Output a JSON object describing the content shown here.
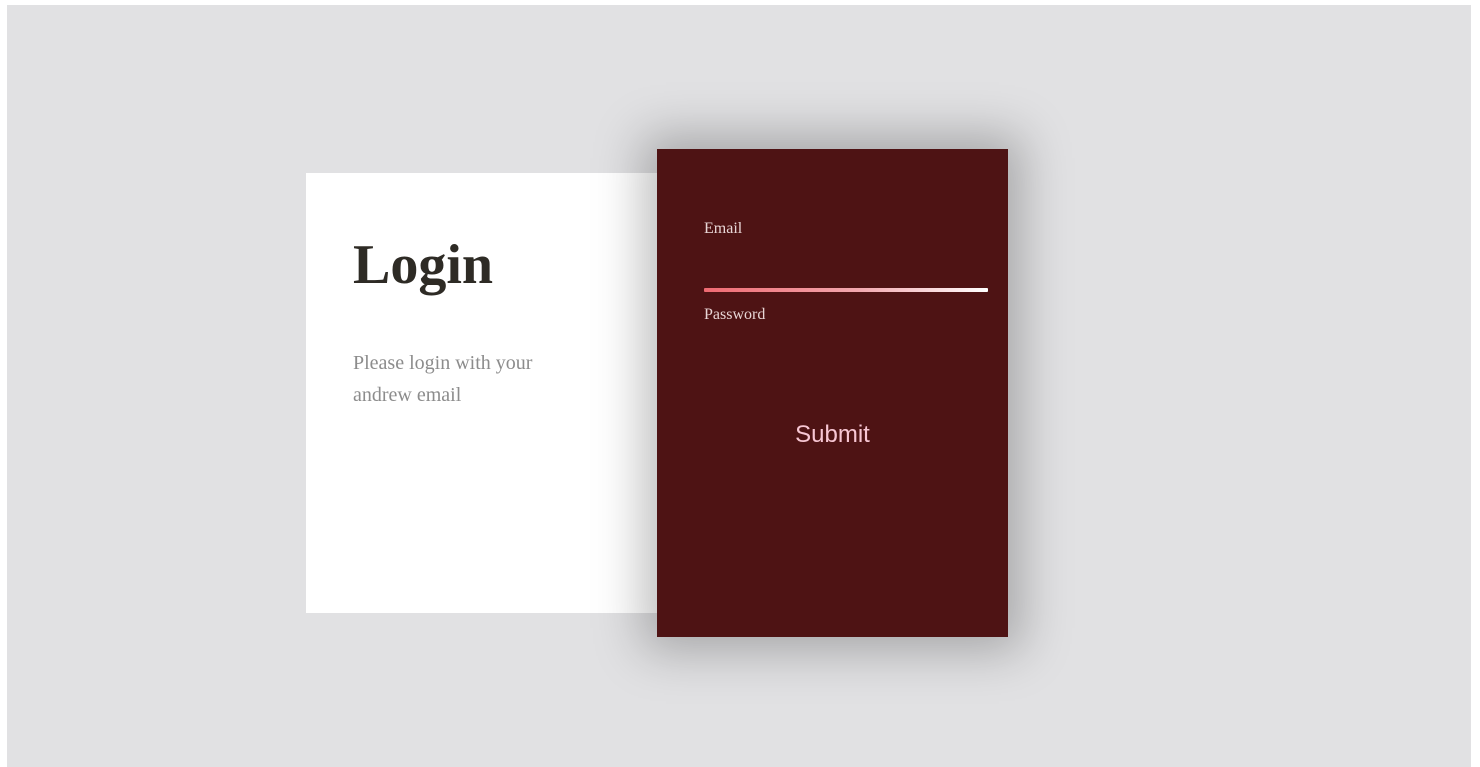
{
  "intro": {
    "title": "Login",
    "description": "Please login with your andrew email"
  },
  "form": {
    "email_label": "Email",
    "email_value": "",
    "password_label": "Password",
    "password_value": "",
    "submit_label": "Submit"
  },
  "colors": {
    "background": "#e1e1e3",
    "form_card": "#4e1314",
    "submit_text": "#f7c6d3",
    "email_underline_start": "#ef6a72",
    "email_underline_end": "#ffffff"
  }
}
